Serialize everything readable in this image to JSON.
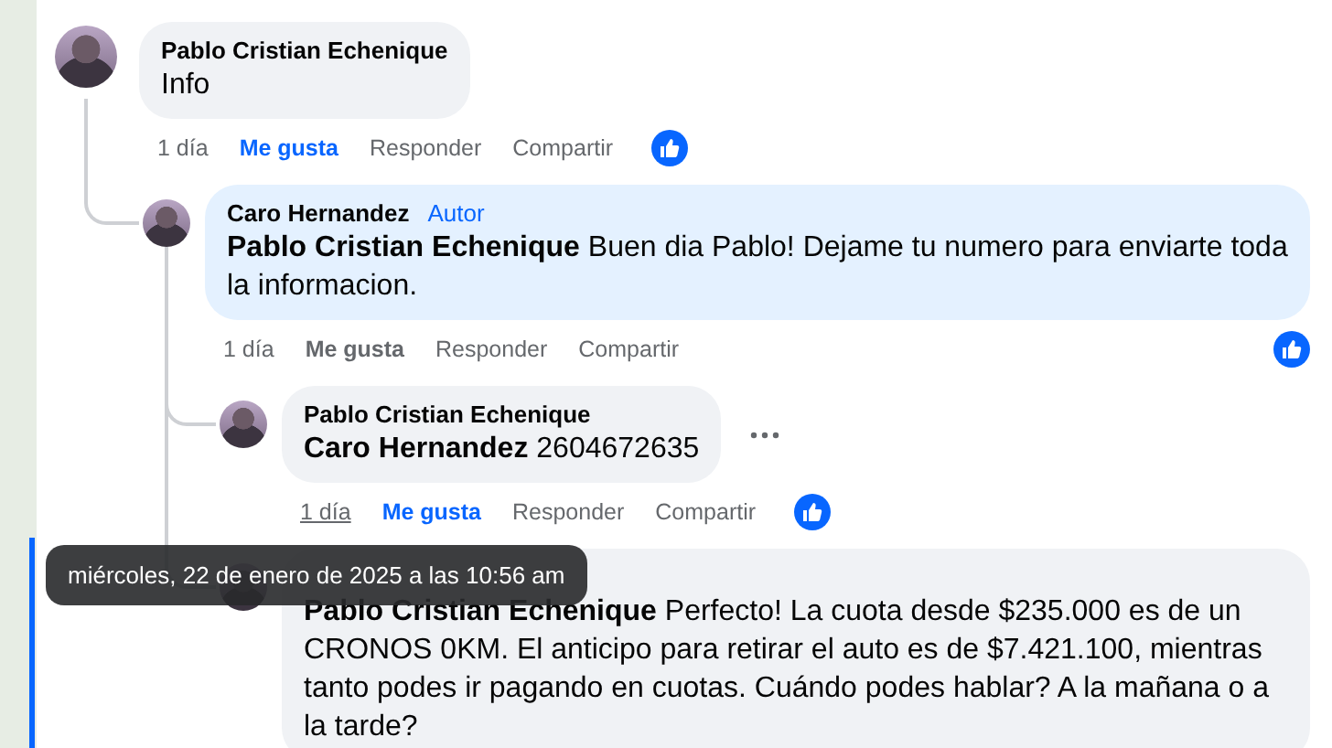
{
  "comments": [
    {
      "author": "Pablo Cristian Echenique",
      "text": "Info",
      "highlighted": false,
      "actions": {
        "time": "1 día",
        "time_hovered": false,
        "like": "Me gusta",
        "liked": true,
        "reply": "Responder",
        "share": "Compartir",
        "reactions": true
      },
      "replies": [
        {
          "author": "Caro Hernandez",
          "badge": "Autor",
          "mention": "Pablo Cristian Echenique",
          "text": "Buen dia Pablo! Dejame tu numero para enviarte toda la informacion.",
          "highlighted": true,
          "actions": {
            "time": "1 día",
            "time_hovered": false,
            "like": "Me gusta",
            "liked": false,
            "reply": "Responder",
            "share": "Compartir",
            "reactions": true
          },
          "replies": [
            {
              "author": "Pablo Cristian Echenique",
              "mention": "Caro Hernandez",
              "text": "2604672635",
              "highlighted": false,
              "show_more": true,
              "actions": {
                "time": "1 día",
                "time_hovered": true,
                "like": "Me gusta",
                "liked": true,
                "reply": "Responder",
                "share": "Compartir",
                "reactions": true
              }
            },
            {
              "mention": "Pablo Cristian Echenique",
              "text": "Perfecto! La cuota desde $235.000 es de un CRONOS 0KM. El anticipo para retirar el auto es de $7.421.100, mientras tanto podes ir pagando en cuotas. Cuándo podes hablar? A la mañana o a la tarde?",
              "highlighted": false,
              "focused": true
            }
          ]
        }
      ]
    }
  ],
  "tooltip": {
    "text": "miércoles, 22 de enero de 2025 a las 10:56 am"
  }
}
